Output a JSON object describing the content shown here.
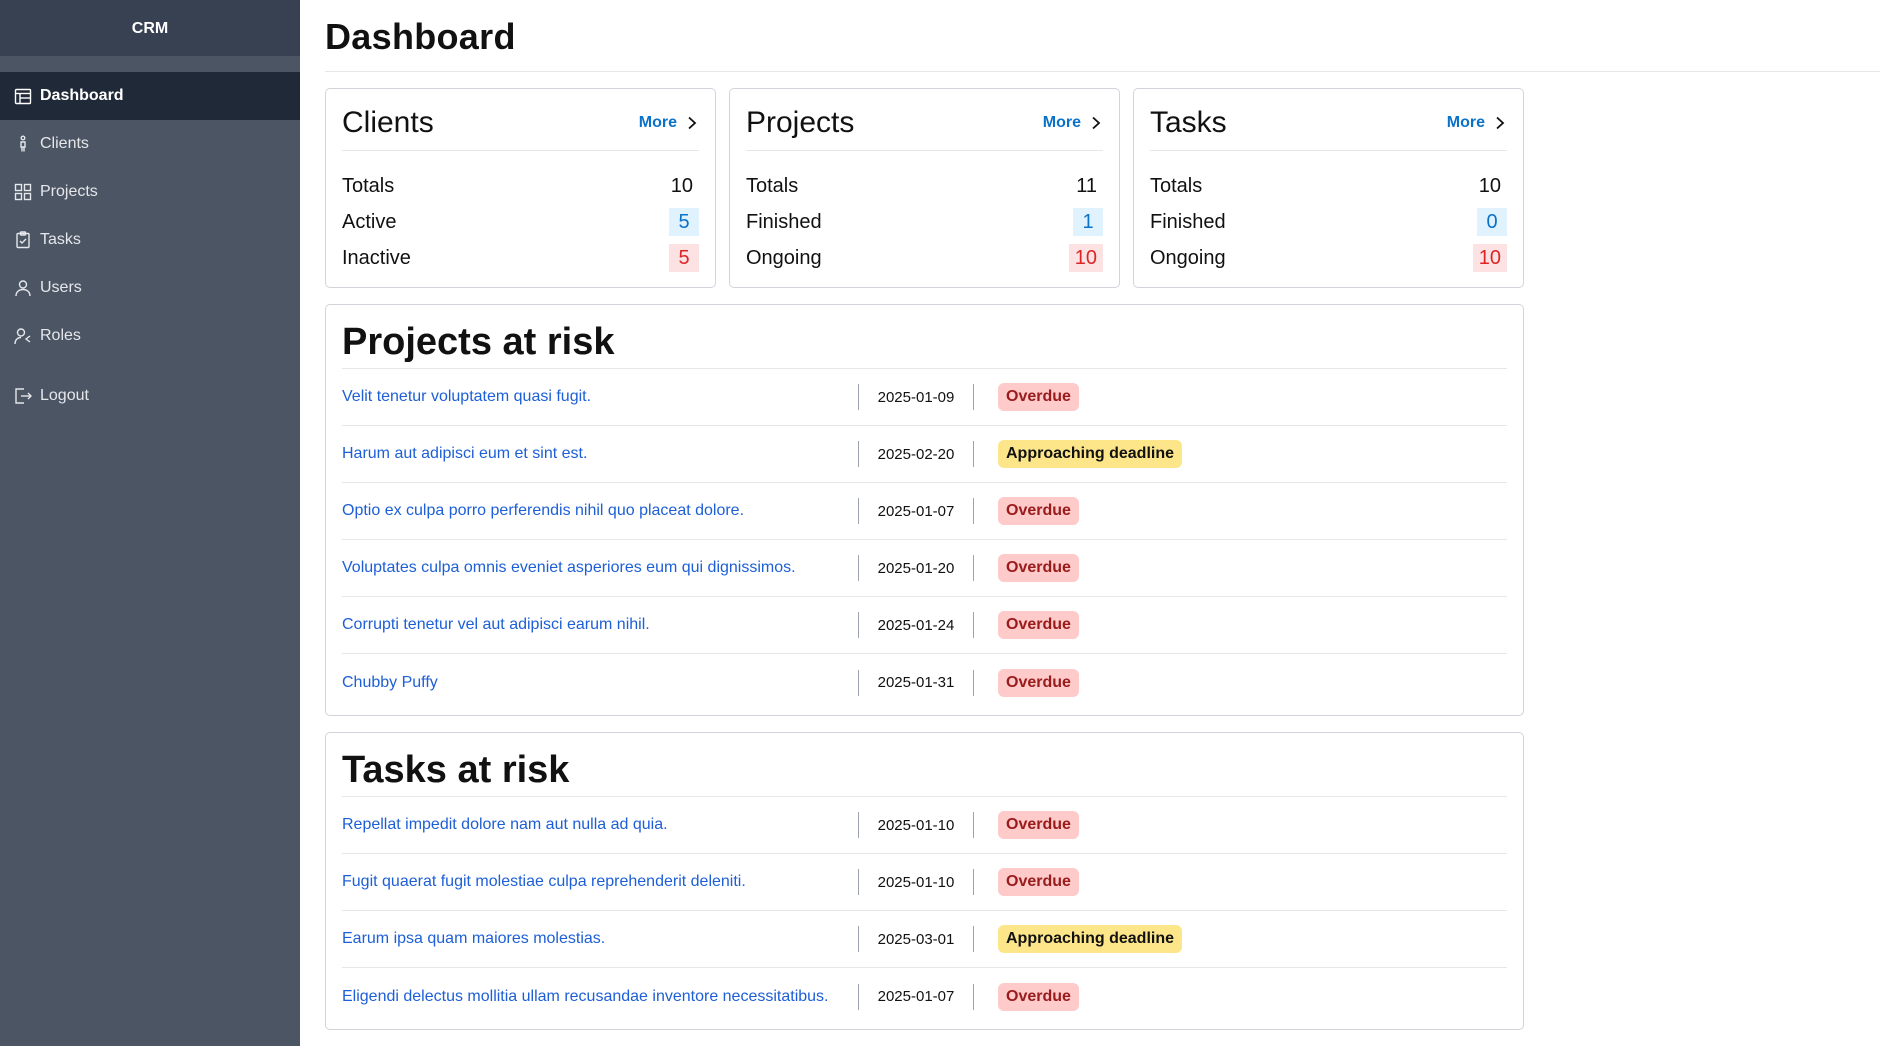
{
  "app": {
    "brand": "CRM"
  },
  "sidebar": {
    "items": [
      {
        "label": "Dashboard",
        "icon": "calendar-icon"
      },
      {
        "label": "Clients",
        "icon": "person-icon"
      },
      {
        "label": "Projects",
        "icon": "grid-icon"
      },
      {
        "label": "Tasks",
        "icon": "clipboard-icon"
      },
      {
        "label": "Users",
        "icon": "user-icon"
      },
      {
        "label": "Roles",
        "icon": "user-key-icon"
      }
    ],
    "logout": {
      "label": "Logout",
      "icon": "logout-icon"
    }
  },
  "page": {
    "title": "Dashboard"
  },
  "stats": {
    "clients": {
      "title": "Clients",
      "more": "More",
      "rows": [
        {
          "label": "Totals",
          "value": "10"
        },
        {
          "label": "Active",
          "value": "5"
        },
        {
          "label": "Inactive",
          "value": "5"
        }
      ]
    },
    "projects": {
      "title": "Projects",
      "more": "More",
      "rows": [
        {
          "label": "Totals",
          "value": "11"
        },
        {
          "label": "Finished",
          "value": "1"
        },
        {
          "label": "Ongoing",
          "value": "10"
        }
      ]
    },
    "tasks": {
      "title": "Tasks",
      "more": "More",
      "rows": [
        {
          "label": "Totals",
          "value": "10"
        },
        {
          "label": "Finished",
          "value": "0"
        },
        {
          "label": "Ongoing",
          "value": "10"
        }
      ]
    }
  },
  "projects_at_risk": {
    "title": "Projects at risk",
    "rows": [
      {
        "name": "Velit tenetur voluptatem quasi fugit.",
        "date": "2025-01-09",
        "status": "Overdue"
      },
      {
        "name": "Harum aut adipisci eum et sint est.",
        "date": "2025-02-20",
        "status": "Approaching deadline"
      },
      {
        "name": "Optio ex culpa porro perferendis nihil quo placeat dolore.",
        "date": "2025-01-07",
        "status": "Overdue"
      },
      {
        "name": "Voluptates culpa omnis eveniet asperiores eum qui dignissimos.",
        "date": "2025-01-20",
        "status": "Overdue"
      },
      {
        "name": "Corrupti tenetur vel aut adipisci earum nihil.",
        "date": "2025-01-24",
        "status": "Overdue"
      },
      {
        "name": "Chubby Puffy",
        "date": "2025-01-31",
        "status": "Overdue"
      }
    ]
  },
  "tasks_at_risk": {
    "title": "Tasks at risk",
    "rows": [
      {
        "name": "Repellat impedit dolore nam aut nulla ad quia.",
        "date": "2025-01-10",
        "status": "Overdue"
      },
      {
        "name": "Fugit quaerat fugit molestiae culpa reprehenderit deleniti.",
        "date": "2025-01-10",
        "status": "Overdue"
      },
      {
        "name": "Earum ipsa quam maiores molestias.",
        "date": "2025-03-01",
        "status": "Approaching deadline"
      },
      {
        "name": "Eligendi delectus mollitia ullam recusandae inventore necessitatibus.",
        "date": "2025-01-07",
        "status": "Overdue"
      }
    ]
  },
  "colors": {
    "sidebar_bg": "#4b5563",
    "sidebar_active": "#1f2937",
    "link": "#1d5fd6",
    "accent": "#0b72c9",
    "overdue_bg": "#fecaca",
    "approaching_bg": "#fde68a"
  }
}
